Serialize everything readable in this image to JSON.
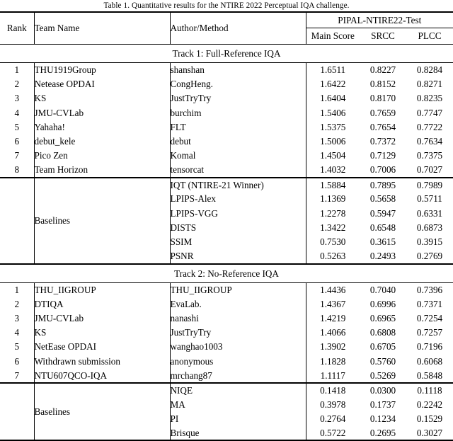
{
  "caption": "Table 1. Quantitative results for the NTIRE 2022 Perceptual IQA challenge.",
  "header": {
    "rank": "Rank",
    "team_name": "Team Name",
    "author_method": "Author/Method",
    "group": "PIPAL-NTIRE22-Test",
    "main_score": "Main Score",
    "srcc": "SRCC",
    "plcc": "PLCC"
  },
  "sections": [
    {
      "title": "Track 1: Full-Reference IQA",
      "rows": [
        {
          "rank": "1",
          "team": "THU1919Group",
          "author": "shanshan",
          "main": "1.6511",
          "srcc": "0.8227",
          "plcc": "0.8284"
        },
        {
          "rank": "2",
          "team": "Netease OPDAI",
          "author": "CongHeng.",
          "main": "1.6422",
          "srcc": "0.8152",
          "plcc": "0.8271"
        },
        {
          "rank": "3",
          "team": "KS",
          "author": "JustTryTry",
          "main": "1.6404",
          "srcc": "0.8170",
          "plcc": "0.8235"
        },
        {
          "rank": "4",
          "team": "JMU-CVLab",
          "author": "burchim",
          "main": "1.5406",
          "srcc": "0.7659",
          "plcc": "0.7747"
        },
        {
          "rank": "5",
          "team": "Yahaha!",
          "author": "FLT",
          "main": "1.5375",
          "srcc": "0.7654",
          "plcc": "0.7722"
        },
        {
          "rank": "6",
          "team": "debut_kele",
          "author": "debut",
          "main": "1.5006",
          "srcc": "0.7372",
          "plcc": "0.7634"
        },
        {
          "rank": "7",
          "team": "Pico Zen",
          "author": "Komal",
          "main": "1.4504",
          "srcc": "0.7129",
          "plcc": "0.7375"
        },
        {
          "rank": "8",
          "team": "Team Horizon",
          "author": "tensorcat",
          "main": "1.4032",
          "srcc": "0.7006",
          "plcc": "0.7027"
        }
      ],
      "baselines_label": "Baselines",
      "baselines": [
        {
          "author": "IQT (NTIRE-21 Winner)",
          "main": "1.5884",
          "srcc": "0.7895",
          "plcc": "0.7989"
        },
        {
          "author": "LPIPS-Alex",
          "main": "1.1369",
          "srcc": "0.5658",
          "plcc": "0.5711"
        },
        {
          "author": "LPIPS-VGG",
          "main": "1.2278",
          "srcc": "0.5947",
          "plcc": "0.6331"
        },
        {
          "author": "DISTS",
          "main": "1.3422",
          "srcc": "0.6548",
          "plcc": "0.6873"
        },
        {
          "author": "SSIM",
          "main": "0.7530",
          "srcc": "0.3615",
          "plcc": "0.3915"
        },
        {
          "author": "PSNR",
          "main": "0.5263",
          "srcc": "0.2493",
          "plcc": "0.2769"
        }
      ]
    },
    {
      "title": "Track 2: No-Reference IQA",
      "rows": [
        {
          "rank": "1",
          "team": "THU_IIGROUP",
          "author": "THU_IIGROUP",
          "main": "1.4436",
          "srcc": "0.7040",
          "plcc": "0.7396"
        },
        {
          "rank": "2",
          "team": "DTIQA",
          "author": "EvaLab.",
          "main": "1.4367",
          "srcc": "0.6996",
          "plcc": "0.7371"
        },
        {
          "rank": "3",
          "team": "JMU-CVLab",
          "author": "nanashi",
          "main": "1.4219",
          "srcc": "0.6965",
          "plcc": "0.7254"
        },
        {
          "rank": "4",
          "team": "KS",
          "author": "JustTryTry",
          "main": "1.4066",
          "srcc": "0.6808",
          "plcc": "0.7257"
        },
        {
          "rank": "5",
          "team": "NetEase OPDAI",
          "author": "wanghao1003",
          "main": "1.3902",
          "srcc": "0.6705",
          "plcc": "0.7196"
        },
        {
          "rank": "6",
          "team": "Withdrawn submission",
          "author": "anonymous",
          "main": "1.1828",
          "srcc": "0.5760",
          "plcc": "0.6068"
        },
        {
          "rank": "7",
          "team": "NTU607QCO-IQA",
          "author": "mrchang87",
          "main": "1.1117",
          "srcc": "0.5269",
          "plcc": "0.5848"
        }
      ],
      "baselines_label": "Baselines",
      "baselines": [
        {
          "author": "NIQE",
          "main": "0.1418",
          "srcc": "0.0300",
          "plcc": "0.1118"
        },
        {
          "author": "MA",
          "main": "0.3978",
          "srcc": "0.1737",
          "plcc": "0.2242"
        },
        {
          "author": "PI",
          "main": "0.2764",
          "srcc": "0.1234",
          "plcc": "0.1529"
        },
        {
          "author": "Brisque",
          "main": "0.5722",
          "srcc": "0.2695",
          "plcc": "0.3027"
        }
      ]
    }
  ]
}
